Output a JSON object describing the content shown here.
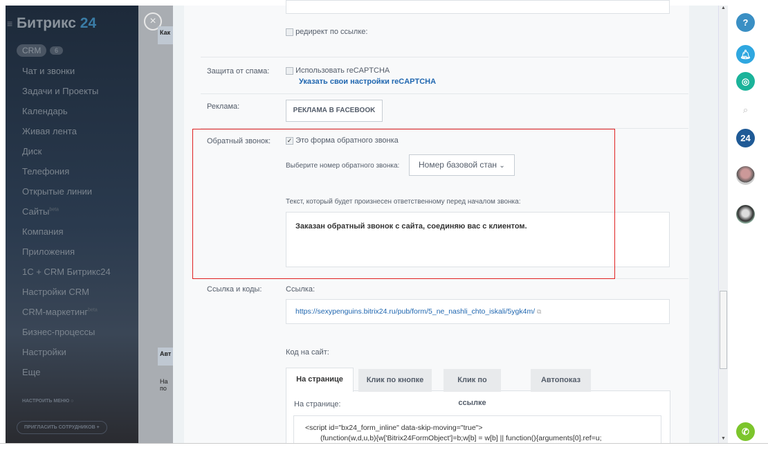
{
  "sidebar": {
    "logo_main": "Битрикс",
    "logo_num": "24",
    "crm": "CRM",
    "crm_count": "6",
    "items": [
      "Чат и звонки",
      "Задачи и Проекты",
      "Календарь",
      "Живая лента",
      "Диск",
      "Телефония",
      "Открытые линии",
      "Сайты",
      "Компания",
      "Приложения",
      "1С + CRM Битрикс24",
      "Настройки CRM",
      "CRM-маркетинг",
      "Бизнес-процессы",
      "Настройки",
      "Еще"
    ],
    "beta": "beta",
    "configure_menu": "НАСТРОИТЬ МЕНЮ",
    "invite": "ПРИГЛАСИТЬ СОТРУДНИКОВ +"
  },
  "bg_cards": {
    "c1": "Как",
    "c2": "Авт",
    "c3": "На по"
  },
  "form": {
    "redirect_label": "редирект по ссылке:",
    "spam_label": "Защита от спама:",
    "recaptcha": "Использовать reCAPTCHA",
    "recaptcha_link": "Указать свои настройки reCAPTCHA",
    "ads_label": "Реклама:",
    "ads_button": "РЕКЛАМА В FACEBOOK",
    "callback_label": "Обратный звонок:",
    "callback_checkbox": "Это форма обратного звонка",
    "number_label": "Выберите номер обратного звонка:",
    "number_value": "Номер базовой стан",
    "text_label": "Текст, который будет произнесен ответственному перед началом звонка:",
    "text_value": "Заказан обратный звонок с сайта, соединяю вас с клиентом.",
    "links_label": "Ссылка и коды:",
    "link_label": "Ссылка:",
    "link_value": "https://sexypenguins.bitrix24.ru/pub/form/5_ne_nashli_chto_iskali/5ygk4m/",
    "code_label": "Код на сайт:",
    "tabs": [
      "На странице",
      "Клик по кнопке",
      "Клик по ссылке",
      "Автопоказ"
    ],
    "tab_content_label": "На странице:",
    "code_line1": "<script id=\"bx24_form_inline\" data-skip-moving=\"true\">",
    "code_line2": "(function(w,d,u,b){w['Bitrix24FormObject']=b;w[b] = w[b] || function(){arguments[0].ref=u;"
  },
  "rightbar": {
    "help": "?",
    "b24": "24"
  },
  "colors": {
    "accent": "#2067b0",
    "highlight": "#e02020",
    "phone": "#8bc34a"
  }
}
